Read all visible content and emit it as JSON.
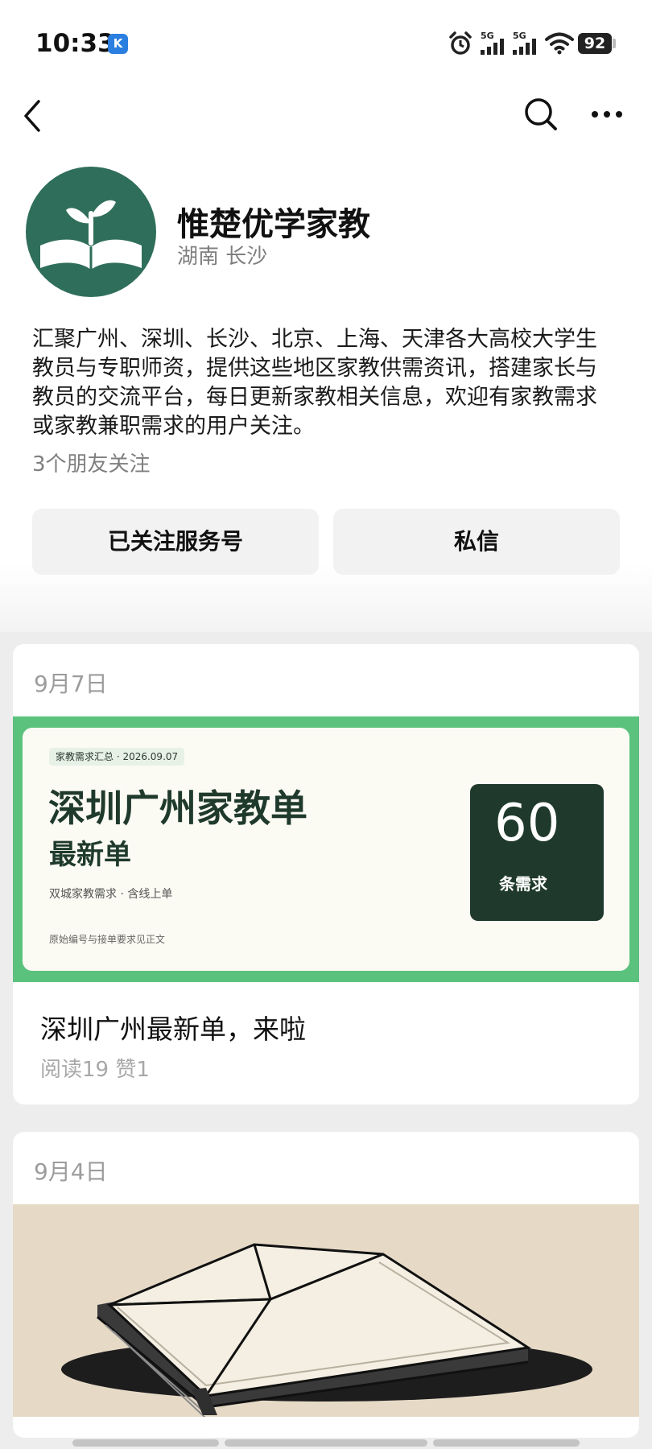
{
  "status_bar": {
    "time": "10:33",
    "k_badge": "K",
    "battery": "92",
    "icons": [
      "alarm-icon",
      "signal-5g-icon",
      "signal-5g-icon",
      "wifi-icon",
      "battery-icon"
    ],
    "signal_label_1": "5G",
    "signal_label_2": "5G"
  },
  "nav": {
    "back_icon": "chevron-left-icon",
    "search_icon": "search-icon",
    "more_icon": "more-icon"
  },
  "profile": {
    "name": "惟楚优学家教",
    "location": "湖南 长沙",
    "description": "汇聚广州、深圳、长沙、北京、上海、天津各大高校大学生教员与专职师资，提供这些地区家教供需资讯，搭建家长与教员的交流平台，每日更新家教相关信息，欢迎有家教需求或家教兼职需求的用户关注。",
    "followers": "3个朋友关注",
    "follow_button": "已关注服务号",
    "message_button": "私信"
  },
  "articles": [
    {
      "date": "9月7日",
      "cover": {
        "tag": "家教需求汇总 · 2026.09.07",
        "title": "深圳广州家教单",
        "subtitle": "最新单",
        "tags": "双城家教需求 · 含线上单",
        "note": "原始编号与接单要求见正文",
        "count": "60",
        "count_unit": "条需求"
      },
      "title": "深圳广州最新单，来啦",
      "stats": "阅读19  赞1"
    },
    {
      "date": "9月4日"
    }
  ],
  "colors": {
    "brand_green": "#2f6e5a",
    "banner_border": "#5bc27d",
    "banner_dark": "#1f3a2c",
    "page_bg": "#ededed",
    "secondary_text": "#7f7f7f"
  }
}
